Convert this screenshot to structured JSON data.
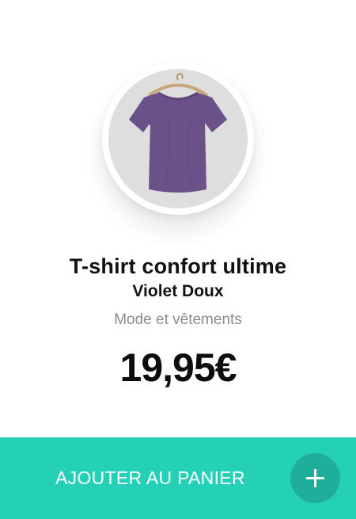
{
  "product": {
    "image_icon": "purple-tshirt-on-hanger",
    "title": "T-shirt confort ultime",
    "variant": "Violet Doux",
    "category": "Mode et vêtements",
    "price": "19,95€"
  },
  "cart": {
    "button_label": "AJOUTER AU PANIER",
    "add_icon": "plus-icon"
  },
  "colors": {
    "accent": "#24d1b6",
    "accent_dark": "#1fae99",
    "shirt": "#6a5289"
  }
}
